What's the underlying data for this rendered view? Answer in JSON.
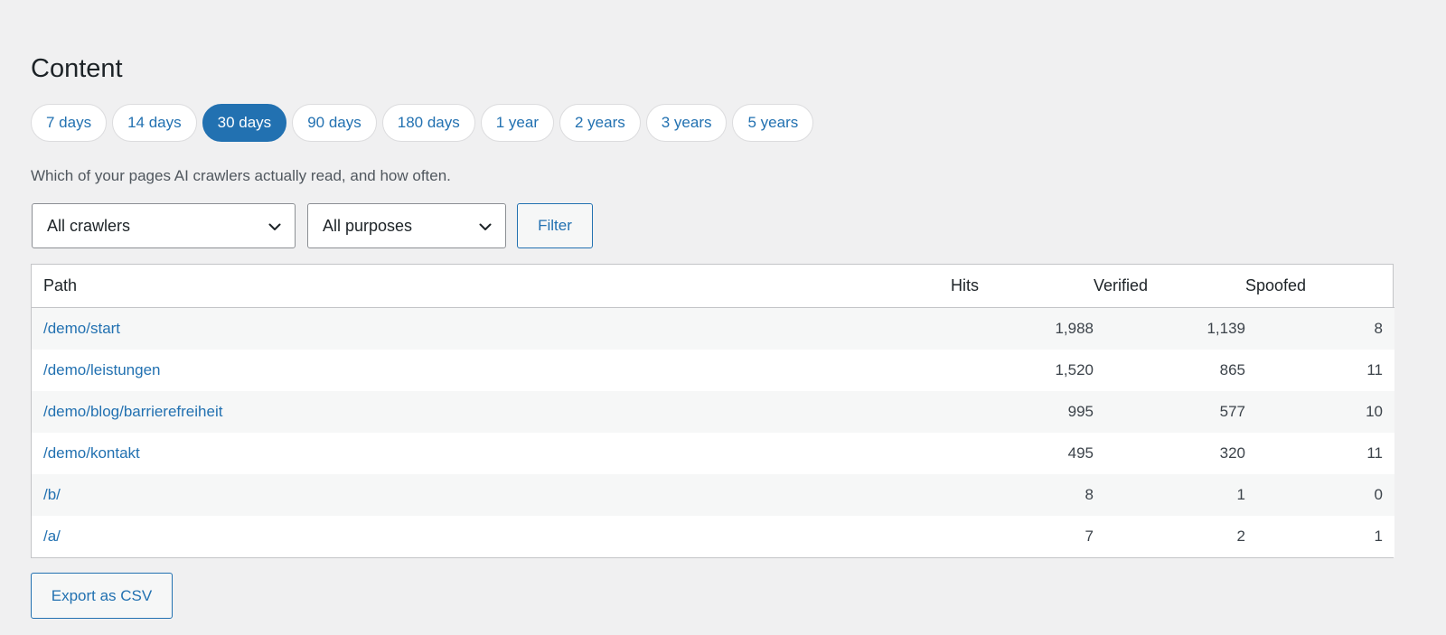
{
  "page": {
    "title": "Content",
    "description": "Which of your pages AI crawlers actually read, and how often."
  },
  "ranges": [
    {
      "label": "7 days",
      "active": false
    },
    {
      "label": "14 days",
      "active": false
    },
    {
      "label": "30 days",
      "active": true
    },
    {
      "label": "90 days",
      "active": false
    },
    {
      "label": "180 days",
      "active": false
    },
    {
      "label": "1 year",
      "active": false
    },
    {
      "label": "2 years",
      "active": false
    },
    {
      "label": "3 years",
      "active": false
    },
    {
      "label": "5 years",
      "active": false
    }
  ],
  "filters": {
    "crawler_select": "All crawlers",
    "purpose_select": "All purposes",
    "filter_label": "Filter"
  },
  "table": {
    "headers": {
      "path": "Path",
      "hits": "Hits",
      "verified": "Verified",
      "spoofed": "Spoofed"
    },
    "rows": [
      {
        "path": "/demo/start",
        "hits": "1,988",
        "verified": "1,139",
        "spoofed": "8"
      },
      {
        "path": "/demo/leistungen",
        "hits": "1,520",
        "verified": "865",
        "spoofed": "11"
      },
      {
        "path": "/demo/blog/barrierefreiheit",
        "hits": "995",
        "verified": "577",
        "spoofed": "10"
      },
      {
        "path": "/demo/kontakt",
        "hits": "495",
        "verified": "320",
        "spoofed": "11"
      },
      {
        "path": "/b/",
        "hits": "8",
        "verified": "1",
        "spoofed": "0"
      },
      {
        "path": "/a/",
        "hits": "7",
        "verified": "2",
        "spoofed": "1"
      }
    ]
  },
  "export": {
    "label": "Export as CSV"
  },
  "colors": {
    "accent": "#2271b1",
    "background": "#f0f0f1",
    "text": "#1d2327",
    "muted_text": "#50575e",
    "border": "#c3c4c7",
    "row_alt": "#f6f7f7"
  },
  "icons": {
    "dropdown": "chevron-down-icon"
  }
}
